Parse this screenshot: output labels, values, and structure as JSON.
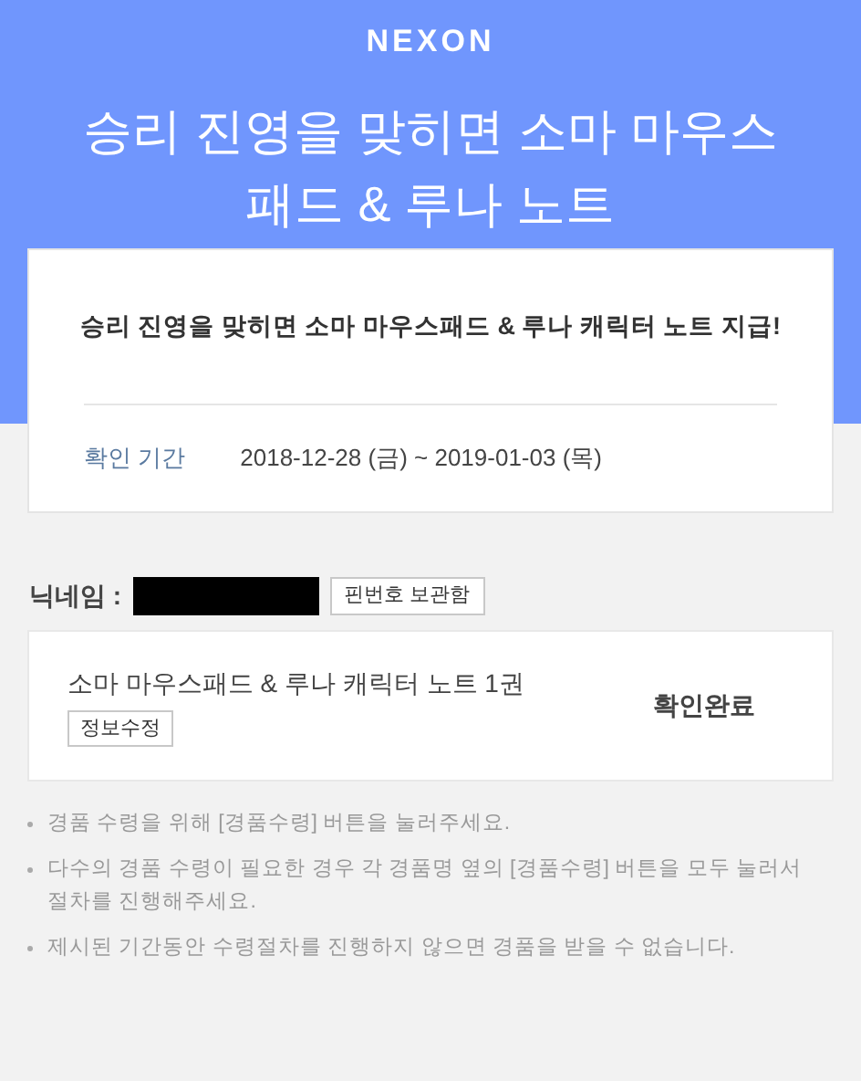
{
  "header": {
    "logo": "NEXON",
    "title": "승리 진영을 맞히면 소마 마우스 패드 & 루나 노트"
  },
  "summary": {
    "headline": "승리 진영을 맞히면 소마 마우스패드 & 루나 캐릭터 노트 지급!",
    "period_label": "확인 기간",
    "period_value": "2018-12-28 (금) ~ 2019-01-03 (목)"
  },
  "nickname": {
    "label": "닉네임 :",
    "redacted": true,
    "pin_button": "핀번호 보관함"
  },
  "prize": {
    "name": "소마 마우스패드 & 루나 캐릭터 노트 1권",
    "edit_button": "정보수정",
    "status": "확인완료"
  },
  "notes": [
    "경품 수령을 위해 [경품수령] 버튼을 눌러주세요.",
    "다수의 경품 수령이 필요한 경우 각 경품명 옆의 [경품수령] 버튼을 모두 눌러서 절차를 진행해주세요.",
    "제시된 기간동안 수령절차를 진행하지 않으면 경품을 받을 수 없습니다."
  ]
}
